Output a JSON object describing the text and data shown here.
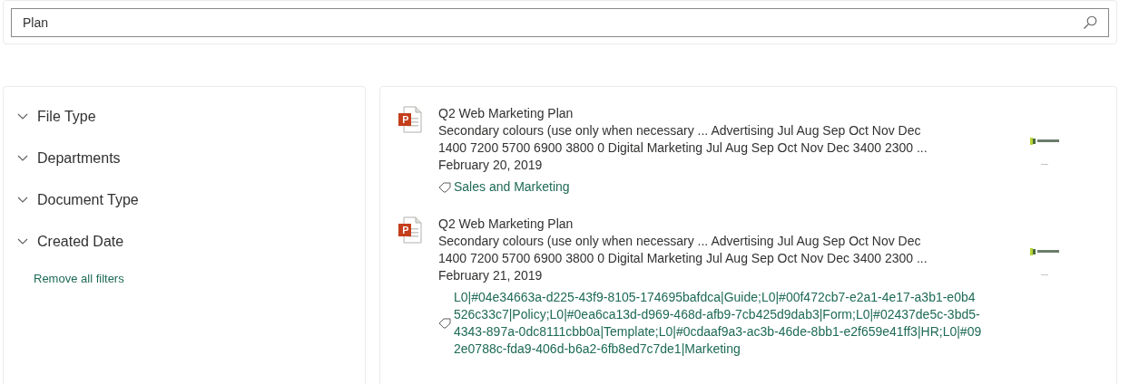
{
  "search": {
    "value": "Plan"
  },
  "filters": [
    {
      "label": "File Type",
      "expanded": false
    },
    {
      "label": "Departments",
      "expanded": false
    },
    {
      "label": "Document Type",
      "expanded": false
    },
    {
      "label": "Created Date",
      "expanded": false
    }
  ],
  "remove_filters": "Remove all filters",
  "results": [
    {
      "title": "Q2 Web Marketing Plan",
      "snippet": "Secondary colours (use only when necessary ... Advertising Jul Aug Sep Oct Nov Dec 1400 7200 5700 6900 3800 0 Digital Marketing Jul Aug Sep Oct Nov Dec 3400 2300 ...",
      "date": "February 20, 2019",
      "tag": "Sales and Marketing"
    },
    {
      "title": "Q2 Web Marketing Plan",
      "snippet": "Secondary colours (use only when necessary ... Advertising Jul Aug Sep Oct Nov Dec 1400 7200 5700 6900 3800 0 Digital Marketing Jul Aug Sep Oct Nov Dec 3400 2300 ...",
      "date": "February 21, 2019",
      "tag": "L0|#04e34663a-d225-43f9-8105-174695bafdca|Guide;L0|#00f472cb7-e2a1-4e17-a3b1-e0b4526c33c7|Policy;L0|#0ea6ca13d-d969-468d-afb9-7cb425d9dab3|Form;L0|#02437de5c-3bd5-4343-897a-0dc8111cbb0a|Template;L0|#0cdaaf9a3-ac3b-46de-8bb1-e2f659e41ff3|HR;L0|#092e0788c-fda9-406d-b6a2-6fb8ed7c7de1|Marketing"
    }
  ]
}
